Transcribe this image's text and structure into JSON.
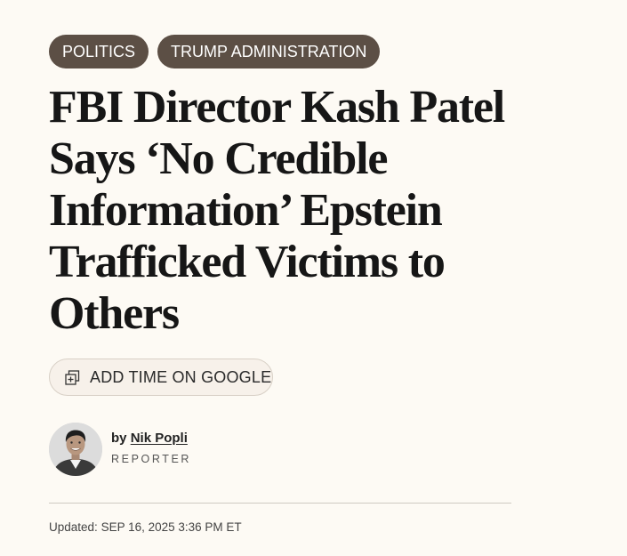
{
  "tags": [
    "POLITICS",
    "TRUMP ADMINISTRATION"
  ],
  "headline": "FBI Director Kash Patel Says ‘No Credible Information’ Epstein Trafficked Victims to Others",
  "google_button": {
    "label": "ADD TIME ON GOOGLE",
    "icon": "add-source-icon"
  },
  "author": {
    "prefix": "by",
    "name": "Nik Popli",
    "role": "REPORTER",
    "avatar_icon": "author-avatar"
  },
  "updated": {
    "label": "Updated:",
    "timestamp": "SEP 16, 2025 3:36 PM ET"
  },
  "colors": {
    "tag_bg": "#5c4f45",
    "page_bg": "#fdfaf4"
  }
}
